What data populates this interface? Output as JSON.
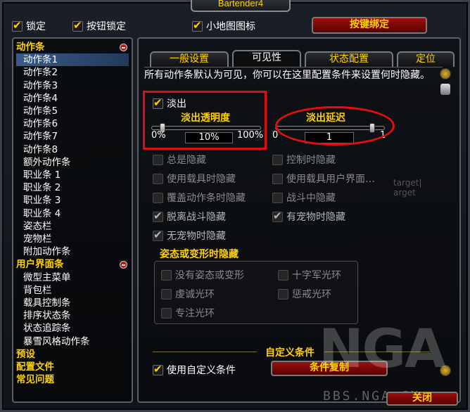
{
  "window": {
    "title": "Bartender4"
  },
  "topbar": {
    "lock": {
      "label": "锁定",
      "checked": true
    },
    "button_lock": {
      "label": "按钮锁定",
      "checked": true
    },
    "minimap_icon": {
      "label": "小地图图标",
      "checked": true
    },
    "keybind_button": "按键绑定"
  },
  "sidebar": {
    "items": [
      {
        "label": "动作条",
        "type": "cat",
        "collapsible": true
      },
      {
        "label": "动作条1",
        "type": "sub",
        "selected": true
      },
      {
        "label": "动作条2",
        "type": "sub"
      },
      {
        "label": "动作条3",
        "type": "sub"
      },
      {
        "label": "动作条4",
        "type": "sub"
      },
      {
        "label": "动作条5",
        "type": "sub"
      },
      {
        "label": "动作条6",
        "type": "sub"
      },
      {
        "label": "动作条7",
        "type": "sub"
      },
      {
        "label": "动作条8",
        "type": "sub"
      },
      {
        "label": "额外动作条",
        "type": "sub"
      },
      {
        "label": "职业条 1",
        "type": "sub"
      },
      {
        "label": "职业条 2",
        "type": "sub"
      },
      {
        "label": "职业条 3",
        "type": "sub"
      },
      {
        "label": "职业条 4",
        "type": "sub"
      },
      {
        "label": "姿态栏",
        "type": "sub"
      },
      {
        "label": "宠物栏",
        "type": "sub"
      },
      {
        "label": "附加动作条",
        "type": "sub"
      },
      {
        "label": "用户界面条",
        "type": "cat",
        "collapsible": true
      },
      {
        "label": "微型主菜单",
        "type": "sub"
      },
      {
        "label": "背包栏",
        "type": "sub"
      },
      {
        "label": "载具控制条",
        "type": "sub"
      },
      {
        "label": "排序状态条",
        "type": "sub"
      },
      {
        "label": "状态追踪条",
        "type": "sub"
      },
      {
        "label": "暴雪风格动作条",
        "type": "sub"
      },
      {
        "label": "预设",
        "type": "cat"
      },
      {
        "label": "配置文件",
        "type": "cat"
      },
      {
        "label": "常见问题",
        "type": "cat"
      }
    ]
  },
  "tabs": [
    "一般设置",
    "可见性",
    "状态配置",
    "定位"
  ],
  "active_tab": "可见性",
  "visibility": {
    "description": "所有动作条默认为可见，你可以在这里配置条件来设置何时隐藏。",
    "fade_out": {
      "label": "淡出",
      "checked": true
    },
    "fade_alpha": {
      "label": "淡出透明度",
      "min": "0%",
      "max": "100%",
      "value": "10%",
      "fraction": 0.1
    },
    "fade_delay": {
      "label": "淡出延迟",
      "min": "0",
      "max": "1",
      "value": "1",
      "fraction": 1.0
    },
    "options": [
      {
        "label": "总是隐藏",
        "checked": false,
        "enabled": false
      },
      {
        "label": "控制时隐藏",
        "checked": false,
        "enabled": false
      },
      {
        "label": "使用载具时隐藏",
        "checked": false,
        "enabled": false
      },
      {
        "label": "使用载具用户界面…",
        "checked": false,
        "enabled": false
      },
      {
        "label": "覆盖动作条时隐藏",
        "checked": false,
        "enabled": false
      },
      {
        "label": "战斗中隐藏",
        "checked": false,
        "enabled": false
      },
      {
        "label": "脱离战斗隐藏",
        "checked": true,
        "enabled": false
      },
      {
        "label": "有宠物时隐藏",
        "checked": true,
        "enabled": false
      },
      {
        "label": "无宠物时隐藏",
        "checked": true,
        "enabled": false
      }
    ],
    "stance_group": {
      "title": "姿态或变形时隐藏",
      "options": [
        {
          "label": "没有姿态或变形",
          "checked": false
        },
        {
          "label": "十字军光环",
          "checked": false
        },
        {
          "label": "虔诚光环",
          "checked": false
        },
        {
          "label": "惩戒光环",
          "checked": false
        },
        {
          "label": "专注光环",
          "checked": false
        }
      ]
    },
    "custom_section": "自定义条件",
    "use_custom": {
      "label": "使用自定义条件",
      "checked": true
    },
    "copy_button": "条件复制"
  },
  "ghost_text": [
    "target|",
    "arget"
  ],
  "close_button": "关闭",
  "watermark": {
    "logo": "NGA",
    "url": "BBS.NGA.CN"
  }
}
